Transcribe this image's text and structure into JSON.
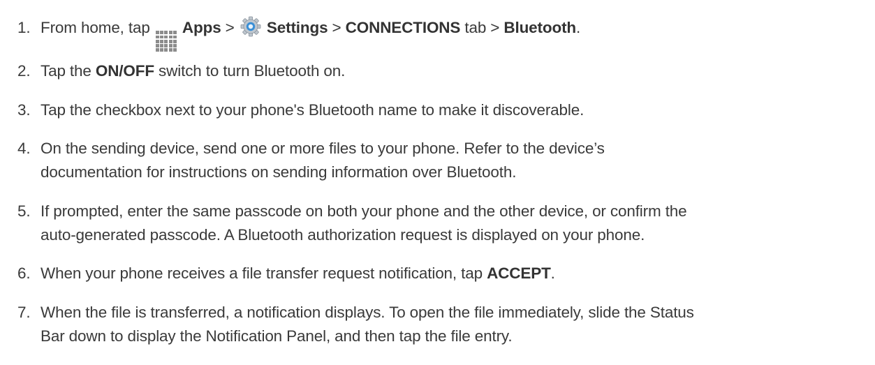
{
  "steps": [
    {
      "number": "1.",
      "parts": {
        "a": "From home, tap ",
        "apps": "Apps",
        "b": " > ",
        "settings": "Settings",
        "c": " > ",
        "connections": "CONNECTIONS",
        "d": " tab > ",
        "bluetooth": "Bluetooth",
        "e": "."
      },
      "icons": [
        "apps-grid-icon",
        "settings-gear-icon"
      ]
    },
    {
      "number": "2.",
      "parts": {
        "a": "Tap the ",
        "onoff": "ON/OFF",
        "b": " switch to turn Bluetooth on."
      }
    },
    {
      "number": "3.",
      "text": "Tap the checkbox next to your phone's Bluetooth name to make it discoverable."
    },
    {
      "number": "4.",
      "line1": "On the sending device, send one or more files to your phone. Refer to the device’s",
      "line2": "documentation for instructions on sending information over Bluetooth."
    },
    {
      "number": "5.",
      "line1": "If prompted, enter the same passcode on both your phone and the other device, or confirm the",
      "line2": "auto-generated passcode. A Bluetooth authorization request is displayed on your phone."
    },
    {
      "number": "6.",
      "parts": {
        "a": "When your phone receives a file transfer request notification, tap ",
        "accept": "ACCEPT",
        "b": "."
      }
    },
    {
      "number": "7.",
      "line1": "When the file is transferred, a notification displays. To open the file immediately, slide the Status",
      "line2": "Bar down to display the Notification Panel, and then tap the file entry."
    }
  ],
  "colors": {
    "text": "#3a3a3a",
    "icon_grid": "#8c8c8c",
    "gear_blue": "#3a8fd6"
  }
}
